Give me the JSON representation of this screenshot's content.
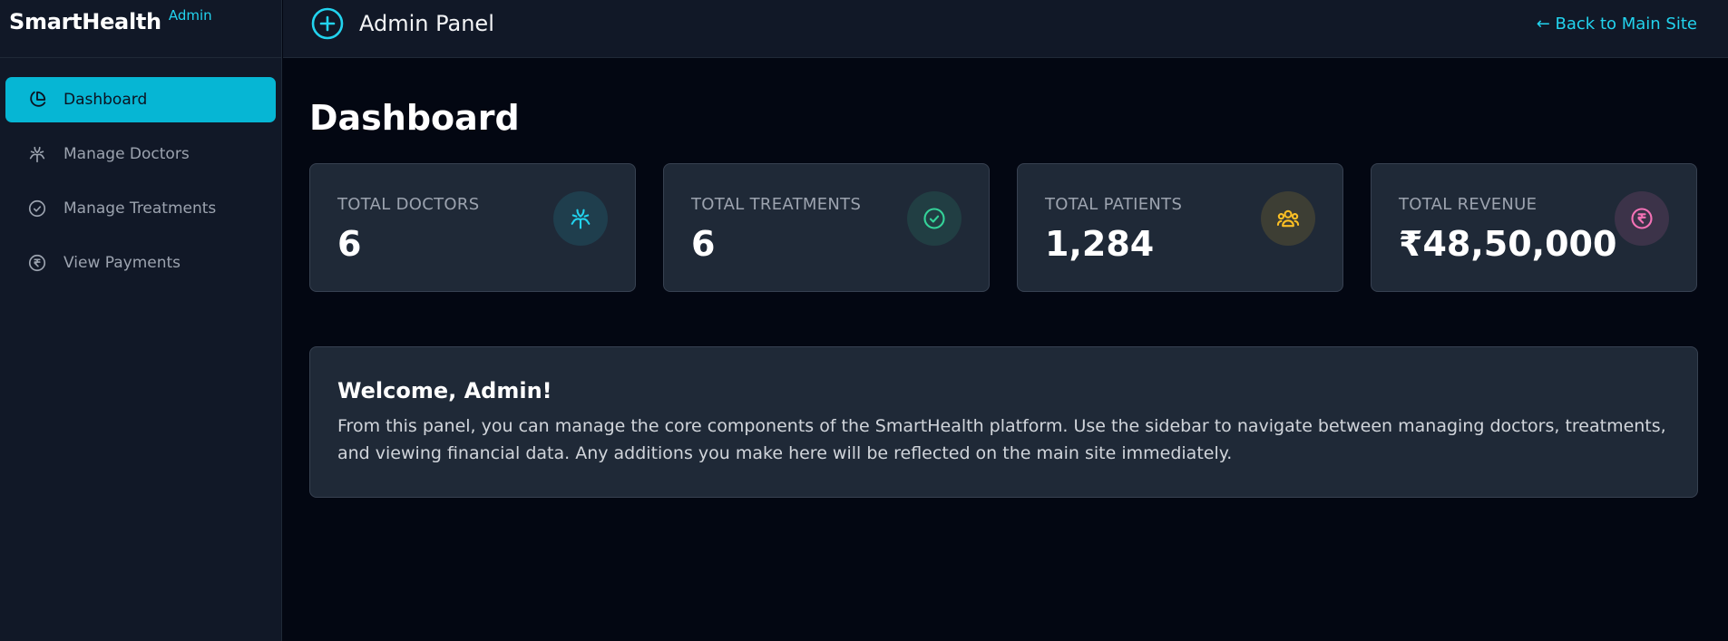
{
  "brand": {
    "name": "SmartHealth",
    "sub": "Admin"
  },
  "header": {
    "title": "Admin Panel",
    "back_link": "← Back to Main Site"
  },
  "sidebar": {
    "items": [
      {
        "label": "Dashboard",
        "icon": "pie-chart-icon",
        "active": true
      },
      {
        "label": "Manage Doctors",
        "icon": "doctor-icon",
        "active": false
      },
      {
        "label": "Manage Treatments",
        "icon": "check-circle-icon",
        "active": false
      },
      {
        "label": "View Payments",
        "icon": "rupee-icon",
        "active": false
      }
    ]
  },
  "main": {
    "title": "Dashboard",
    "stats": [
      {
        "label": "TOTAL DOCTORS",
        "value": "6",
        "icon": "doctor-icon",
        "color": "#22d3ee"
      },
      {
        "label": "TOTAL TREATMENTS",
        "value": "6",
        "icon": "check-circle-icon",
        "color": "#34d399"
      },
      {
        "label": "TOTAL PATIENTS",
        "value": "1,284",
        "icon": "users-icon",
        "color": "#fbbf24"
      },
      {
        "label": "TOTAL REVENUE",
        "value": "₹48,50,000",
        "icon": "rupee-icon",
        "color": "#f472b6"
      }
    ],
    "welcome": {
      "title": "Welcome, Admin!",
      "text": "From this panel, you can manage the core components of the SmartHealth platform. Use the sidebar to navigate between managing doctors, treatments, and viewing financial data. Any additions you make here will be reflected on the main site immediately."
    }
  },
  "colors": {
    "accent": "#06b6d4",
    "link": "#22d3ee",
    "background": "#030712",
    "panel": "#111827",
    "card": "#1f2937"
  }
}
